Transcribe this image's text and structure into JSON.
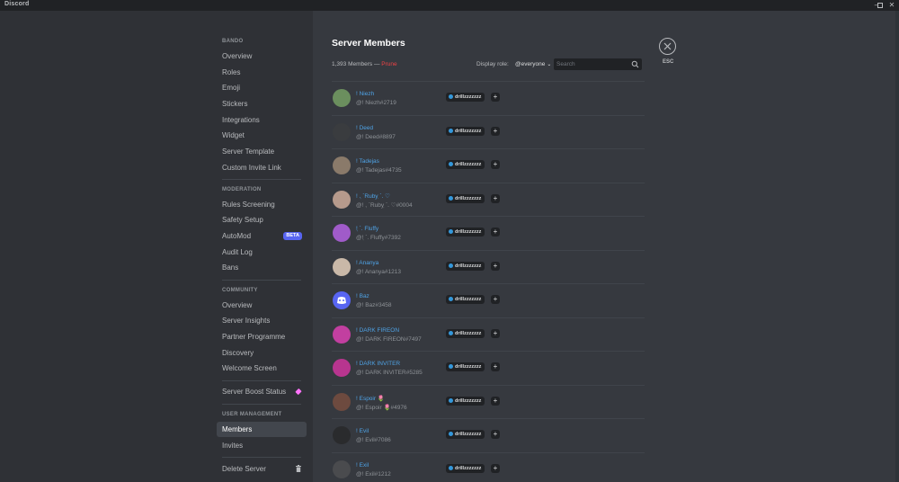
{
  "window": {
    "app_title": "Discord",
    "controls": [
      "minimize",
      "maximize",
      "close"
    ]
  },
  "sidebar": {
    "sections": [
      {
        "header": "BANDO",
        "items": [
          "Overview",
          "Roles",
          "Emoji",
          "Stickers",
          "Integrations",
          "Widget",
          "Server Template",
          "Custom Invite Link"
        ]
      },
      {
        "header": "MODERATION",
        "items": [
          "Rules Screening",
          "Safety Setup",
          "AutoMod",
          "Audit Log",
          "Bans"
        ]
      },
      {
        "header": "COMMUNITY",
        "items": [
          "Overview",
          "Server Insights",
          "Partner Programme",
          "Discovery",
          "Welcome Screen"
        ]
      },
      {
        "header": "",
        "items": [
          "Server Boost Status"
        ]
      },
      {
        "header": "USER MANAGEMENT",
        "items": [
          "Members",
          "Invites"
        ]
      },
      {
        "header": "",
        "items": [
          "Delete Server"
        ]
      }
    ],
    "automod_badge": "BETA",
    "selected_item": "Members",
    "colors": {
      "selected_bg": "#42464d",
      "badge": "#5865f2",
      "boost": "#ff73fa"
    }
  },
  "main": {
    "title": "Server Members",
    "members_count": "1,393 Members",
    "separator": " — ",
    "prune_label": "Prune",
    "display_role_label": "Display role:",
    "display_role_value": "@everyone",
    "search": {
      "placeholder": "Search",
      "value": ""
    },
    "members": [
      {
        "name": "! Niezh",
        "tag": "@! Niezh#2719",
        "role": "drillzzzzzzz",
        "avatar_color": "#6b8f5e"
      },
      {
        "name": "! Deed",
        "tag": "@! Deed#8897",
        "role": "drillzzzzzzz",
        "avatar_color": "#3a3c3f"
      },
      {
        "name": "! Tadejas",
        "tag": "@! Tadejas#4735",
        "role": "drillzzzzzzz",
        "avatar_color": "#8a7a6a"
      },
      {
        "name": "! . ̣`Ruby ̣`. ♡",
        "tag": "@! . ̣`Ruby ̣`. ♡#0004",
        "role": "drillzzzzzzz",
        "avatar_color": "#b69a8c"
      },
      {
        "name": "! ̣`. Fluffy",
        "tag": "@! ̣`. Fluffy#7392",
        "role": "drillzzzzzzz",
        "avatar_color": "#a05bc9"
      },
      {
        "name": "! Ananya",
        "tag": "@! Ananya#1213",
        "role": "drillzzzzzzz",
        "avatar_color": "#c9b8a8"
      },
      {
        "name": "! Baz",
        "tag": "@! Baz#3458",
        "role": "drillzzzzzzz",
        "avatar_color": "#5865f2"
      },
      {
        "name": "! DARK FIREON",
        "tag": "@! DARK FIREON#7497",
        "role": "drillzzzzzzz",
        "avatar_color": "#c23fa0"
      },
      {
        "name": "! DARK INVITER",
        "tag": "@! DARK INVITER#5285",
        "role": "drillzzzzzzz",
        "avatar_color": "#b8358f"
      },
      {
        "name": "! Espoir 🌷",
        "tag": "@! Espoir 🌷#4976",
        "role": "drillzzzzzzz",
        "avatar_color": "#6d4a3f"
      },
      {
        "name": "! Evil",
        "tag": "@! Evil#7086",
        "role": "drillzzzzzzz",
        "avatar_color": "#2a2b2d"
      },
      {
        "name": "! Exil",
        "tag": "@! Exil#1212",
        "role": "drillzzzzzzz",
        "avatar_color": "#4a4b4e"
      }
    ],
    "colors": {
      "name": "#4fa3e6",
      "role_dot": "#3498db",
      "prune": "#ed4245"
    }
  },
  "close": {
    "label": "ESC"
  }
}
